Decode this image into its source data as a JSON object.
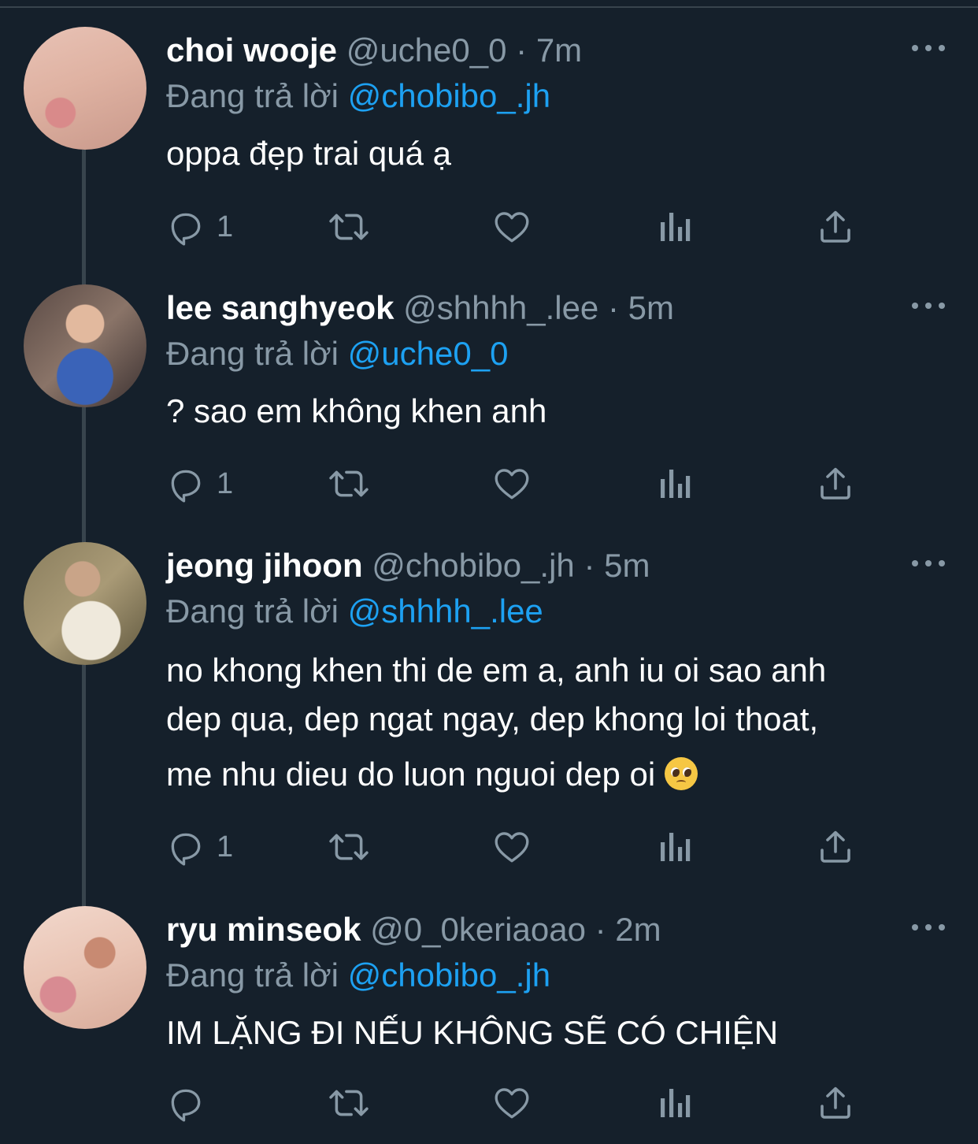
{
  "tweets": [
    {
      "name": "choi wooje",
      "handle": "@uche0_0",
      "time": "7m",
      "reply_prefix": "Đang trả lời",
      "reply_to": "@chobibo_.jh",
      "text": "oppa đẹp trai quá ạ",
      "reply_count": "1"
    },
    {
      "name": "lee sanghyeok",
      "handle": "@shhhh_.lee",
      "time": "5m",
      "reply_prefix": "Đang trả lời",
      "reply_to": "@uche0_0",
      "text": "? sao em không khen anh",
      "reply_count": "1"
    },
    {
      "name": "jeong jihoon",
      "handle": "@chobibo_.jh",
      "time": "5m",
      "reply_prefix": "Đang trả lời",
      "reply_to": "@shhhh_.lee",
      "text_line1": "no khong khen thi de em a, anh iu oi sao anh",
      "text_line2": "dep qua, dep ngat ngay, dep khong loi thoat,",
      "text_line3": "me nhu dieu do luon nguoi dep oi",
      "emoji": "pleading-face",
      "reply_count": "1"
    },
    {
      "name": "ryu minseok",
      "handle": "@0_0keriaoao",
      "time": "2m",
      "reply_prefix": "Đang trả lời",
      "reply_to": "@chobibo_.jh",
      "text": "IM LẶNG ĐI NẾU KHÔNG SẼ CÓ CHIỆN",
      "reply_count": ""
    }
  ],
  "separator": "·",
  "icons": [
    "reply-icon",
    "retweet-icon",
    "like-icon",
    "views-icon",
    "share-icon",
    "more-icon"
  ],
  "colors": {
    "background": "#15202b",
    "muted": "#8899a6",
    "link": "#1da1f2",
    "text": "#ffffff",
    "line": "#38444d"
  }
}
